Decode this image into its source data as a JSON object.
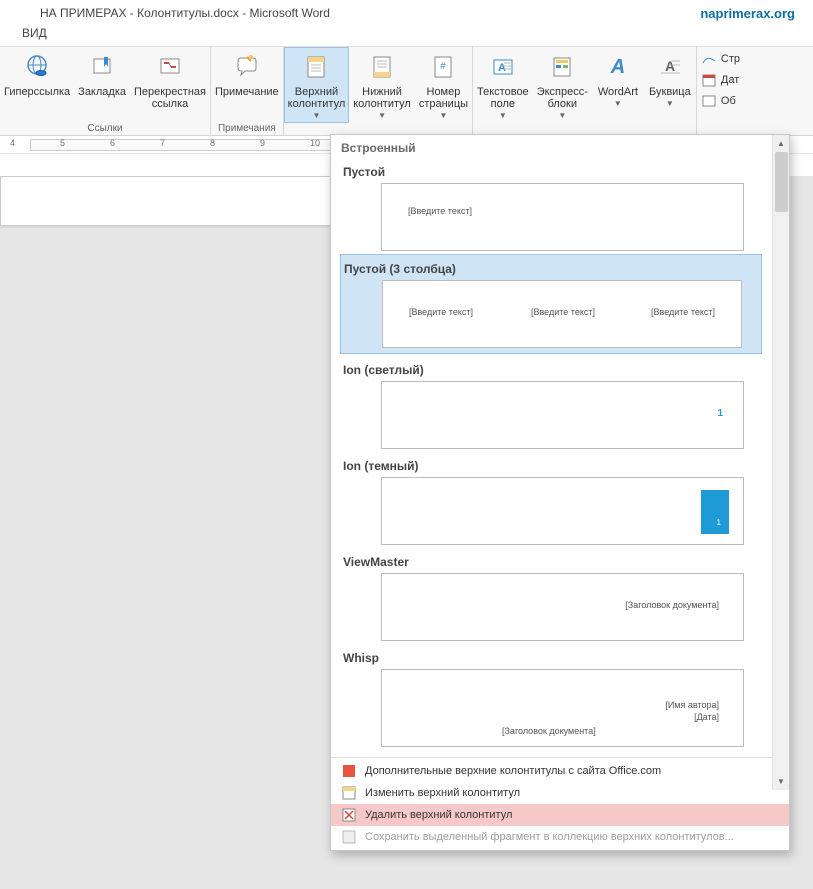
{
  "title": "НА ПРИМЕРАХ - Колонтитулы.docx - Microsoft Word",
  "site_link": "naprimerax.org",
  "tab": "ВИД",
  "ribbon": {
    "groups": [
      {
        "name": "Ссылки",
        "buttons": [
          {
            "label": "Гиперссылка",
            "icon": "globe-link-icon"
          },
          {
            "label": "Закладка",
            "icon": "bookmark-icon"
          },
          {
            "label": "Перекрестная\nссылка",
            "icon": "crossref-icon"
          }
        ]
      },
      {
        "name": "Примечания",
        "buttons": [
          {
            "label": "Примечание",
            "icon": "comment-icon"
          }
        ]
      },
      {
        "name": "",
        "buttons": [
          {
            "label": "Верхний\nколонтитул",
            "icon": "header-icon",
            "selected": true,
            "drop": true
          },
          {
            "label": "Нижний\nколонтитул",
            "icon": "footer-icon",
            "drop": true
          },
          {
            "label": "Номер\nстраницы",
            "icon": "pagenum-icon",
            "drop": true
          }
        ]
      },
      {
        "name": "",
        "buttons": [
          {
            "label": "Текстовое\nполе",
            "icon": "textbox-icon",
            "drop": true
          },
          {
            "label": "Экспресс-\nблоки",
            "icon": "quickparts-icon",
            "drop": true
          },
          {
            "label": "WordArt",
            "icon": "wordart-icon",
            "drop": true
          },
          {
            "label": "Буквица",
            "icon": "dropcap-icon",
            "drop": true
          }
        ]
      }
    ],
    "small": [
      {
        "label": "Стр",
        "icon": "sig-icon"
      },
      {
        "label": "Дат",
        "icon": "date-icon"
      },
      {
        "label": "Об",
        "icon": "obj-icon"
      }
    ]
  },
  "gallery": {
    "header": "Встроенный",
    "items": [
      {
        "title": "Пустой",
        "kind": "blank1",
        "ph": "[Введите текст]"
      },
      {
        "title": "Пустой (3 столбца)",
        "kind": "blank3",
        "ph": "[Введите текст]",
        "selected": true
      },
      {
        "title": "Ion (светлый)",
        "kind": "ionlight",
        "num": "1"
      },
      {
        "title": "Ion (темный)",
        "kind": "iondark",
        "num": "1"
      },
      {
        "title": "ViewMaster",
        "kind": "viewmaster",
        "ph": "[Заголовок документа]"
      },
      {
        "title": "Whisp",
        "kind": "whisp",
        "ph1": "[Имя автора]",
        "ph2": "[Дата]",
        "ph3": "[Заголовок документа]"
      }
    ],
    "menu": [
      {
        "label": "Дополнительные верхние колонтитулы с сайта Office.com",
        "icon": "office-icon",
        "arrow": true
      },
      {
        "label": "Изменить верхний колонтитул",
        "icon": "edit-header-icon"
      },
      {
        "label": "Удалить верхний колонтитул",
        "icon": "delete-header-icon",
        "hl": true
      },
      {
        "label": "Сохранить выделенный фрагмент в коллекцию верхних колонтитулов...",
        "icon": "save-icon",
        "disabled": true
      }
    ]
  },
  "ruler_ticks": [
    "4",
    "5",
    "6",
    "7",
    "8",
    "9",
    "10"
  ]
}
